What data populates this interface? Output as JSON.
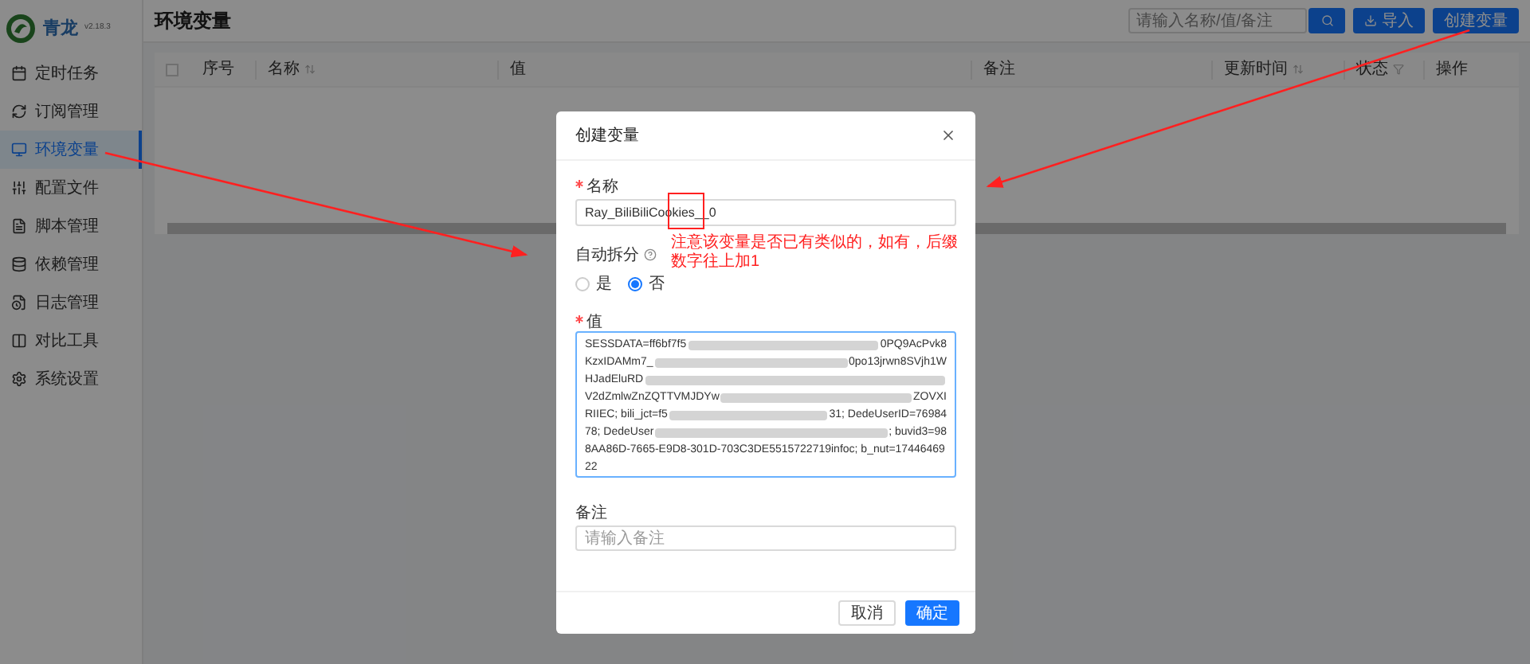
{
  "app": {
    "name": "青龙",
    "version": "v2.18.3"
  },
  "sidebar": {
    "items": [
      {
        "label": "定时任务",
        "selected": false
      },
      {
        "label": "订阅管理",
        "selected": false
      },
      {
        "label": "环境变量",
        "selected": true
      },
      {
        "label": "配置文件",
        "selected": false
      },
      {
        "label": "脚本管理",
        "selected": false
      },
      {
        "label": "依赖管理",
        "selected": false
      },
      {
        "label": "日志管理",
        "selected": false
      },
      {
        "label": "对比工具",
        "selected": false
      },
      {
        "label": "系统设置",
        "selected": false
      }
    ]
  },
  "header": {
    "title": "环境变量",
    "search": {
      "placeholder": "请输入名称/值/备注"
    },
    "buttons": [
      {
        "label": "导入",
        "kind": "import"
      },
      {
        "label": "创建变量",
        "kind": "plain"
      }
    ]
  },
  "table": {
    "select_all_checked": false,
    "columns": [
      {
        "label": "序号",
        "sortable": false,
        "filterable": false
      },
      {
        "label": "名称",
        "sortable": true,
        "filterable": false
      },
      {
        "label": "值",
        "sortable": false,
        "filterable": false
      },
      {
        "label": "备注",
        "sortable": false,
        "filterable": false
      },
      {
        "label": "更新时间",
        "sortable": true,
        "filterable": false
      },
      {
        "label": "状态",
        "sortable": false,
        "filterable": true
      },
      {
        "label": "操作",
        "sortable": false,
        "filterable": false
      }
    ]
  },
  "dialog": {
    "title": "创建变量",
    "name_field": {
      "label": "名称",
      "required": true,
      "value": "Ray_BiliBiliCookies__0"
    },
    "auto_split": {
      "label": "自动拆分",
      "options": [
        {
          "label": "是",
          "selected": false
        },
        {
          "label": "否",
          "selected": true
        }
      ]
    },
    "value_field": {
      "label": "值",
      "required": true,
      "lines": [
        [
          {
            "kind": "text",
            "text": "SESSDATA=ff6bf7f5"
          },
          {
            "kind": "blur"
          },
          {
            "kind": "text",
            "text": "0PQ9AcPvk8"
          }
        ],
        [
          {
            "kind": "text",
            "text": "KzxIDAMm7_"
          },
          {
            "kind": "blur"
          },
          {
            "kind": "text",
            "text": "0po13jrwn8SVjh1W"
          }
        ],
        [
          {
            "kind": "text",
            "text": "HJadEluRD"
          },
          {
            "kind": "blur"
          }
        ],
        [
          {
            "kind": "text",
            "text": "V2dZmlwZnZQTTVMJDYw"
          },
          {
            "kind": "blur"
          },
          {
            "kind": "text",
            "text": "ZOVXI"
          }
        ],
        [
          {
            "kind": "text",
            "text": "RIIEC; bili_jct=f5"
          },
          {
            "kind": "blur"
          },
          {
            "kind": "text",
            "text": "31; DedeUserID=76984"
          }
        ],
        [
          {
            "kind": "text",
            "text": "78; DedeUser"
          },
          {
            "kind": "blur"
          },
          {
            "kind": "text",
            "text": "; buvid3=98"
          }
        ],
        [
          {
            "kind": "text",
            "text": "8AA86D-7665-E9D8-301D-703C3DE5515722719infoc; b_nut=17446469"
          }
        ],
        [
          {
            "kind": "text",
            "text": "22"
          }
        ]
      ]
    },
    "remark_field": {
      "label": "备注",
      "placeholder": "请输入备注"
    },
    "buttons": [
      {
        "label": "取消",
        "kind": "default"
      },
      {
        "label": "确定",
        "kind": "primary"
      }
    ]
  },
  "annotation": {
    "note": "注意该变量是否已有类似的，如有，后缀数字往上加1"
  }
}
